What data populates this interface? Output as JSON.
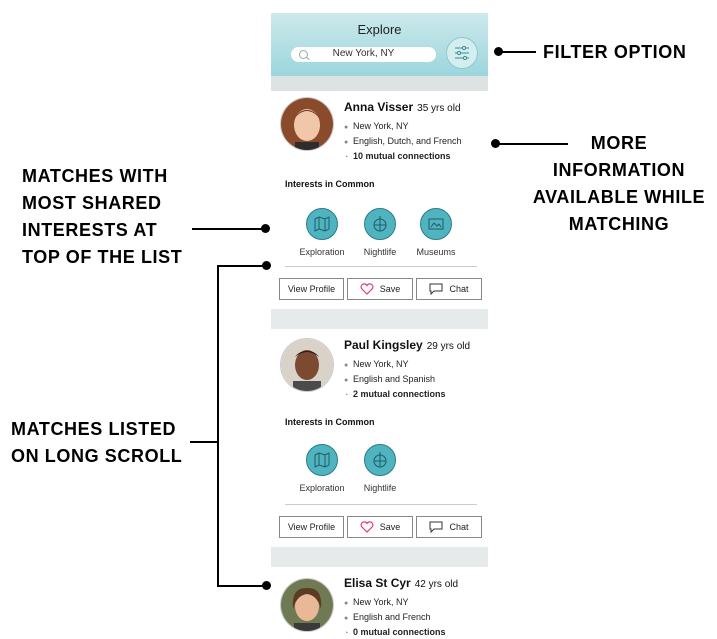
{
  "annotations": {
    "filter": "FILTER OPTION",
    "more_info": [
      "MORE",
      "INFORMATION",
      "AVAILABLE WHILE",
      "MATCHING"
    ],
    "shared": [
      "MATCHES WITH",
      "MOST SHARED",
      "INTERESTS AT",
      "TOP OF THE LIST"
    ],
    "scroll": [
      "MATCHES LISTED",
      "ON LONG SCROLL"
    ]
  },
  "header": {
    "title": "Explore",
    "search_value": "New York, NY",
    "filter_icon": "sliders-icon"
  },
  "interests_title": "Interests in Common",
  "buttons": {
    "view_profile": "View Profile",
    "save": "Save",
    "chat": "Chat"
  },
  "matches": [
    {
      "name": "Anna Visser",
      "age": "35 yrs old",
      "location": "New York, NY",
      "languages": "English, Dutch, and French",
      "mutual": "10 mutual connections",
      "interests": [
        "Exploration",
        "Nightlife",
        "Museums"
      ]
    },
    {
      "name": "Paul Kingsley",
      "age": "29 yrs old",
      "location": "New York, NY",
      "languages": "English and Spanish",
      "mutual": "2 mutual connections",
      "interests": [
        "Exploration",
        "Nightlife"
      ]
    },
    {
      "name": "Elisa St Cyr",
      "age": "42 yrs old",
      "location": "New York, NY",
      "languages": "English and French",
      "mutual": "0 mutual connections"
    }
  ],
  "colors": {
    "header_top": "#cde9ec",
    "header_bottom": "#9bd6dc",
    "interest_icon": "#4fb3c0",
    "heart": "#e0406a"
  }
}
